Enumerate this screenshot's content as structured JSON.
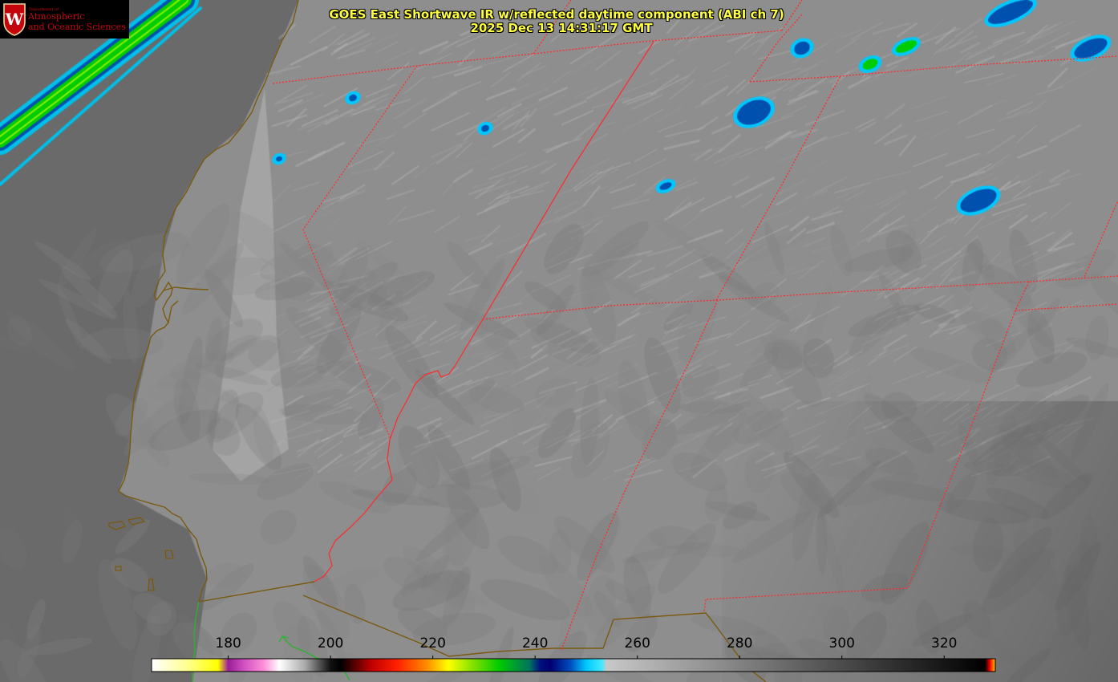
{
  "logo": {
    "dept": "Department of",
    "line1": "Atmospheric",
    "line2": "and Oceanic Sciences",
    "seal_letter": "W"
  },
  "title": {
    "line1": "GOES East Shortwave IR w/reflected daytime component (ABI ch 7)",
    "line2": "2025 Dec 13 14:31:17 GMT"
  },
  "colorbar": {
    "min": 165,
    "max": 330,
    "ticks": [
      180,
      200,
      220,
      240,
      260,
      280,
      300,
      320
    ],
    "stops": [
      {
        "t": 165,
        "color": "#ffffff"
      },
      {
        "t": 172,
        "color": "#ffff90"
      },
      {
        "t": 178,
        "color": "#ffff00"
      },
      {
        "t": 180,
        "color": "#9a1e9a"
      },
      {
        "t": 183,
        "color": "#d050c0"
      },
      {
        "t": 187,
        "color": "#ff90d8"
      },
      {
        "t": 190,
        "color": "#ffffff"
      },
      {
        "t": 195,
        "color": "#aaaaaa"
      },
      {
        "t": 200,
        "color": "#111111"
      },
      {
        "t": 202,
        "color": "#000000"
      },
      {
        "t": 208,
        "color": "#c00000"
      },
      {
        "t": 213,
        "color": "#ff2000"
      },
      {
        "t": 219,
        "color": "#ff9000"
      },
      {
        "t": 223,
        "color": "#ffff00"
      },
      {
        "t": 228,
        "color": "#80e000"
      },
      {
        "t": 233,
        "color": "#00cc00"
      },
      {
        "t": 239,
        "color": "#007060"
      },
      {
        "t": 241,
        "color": "#001080"
      },
      {
        "t": 243,
        "color": "#000070"
      },
      {
        "t": 247,
        "color": "#0050c0"
      },
      {
        "t": 250,
        "color": "#00c8ff"
      },
      {
        "t": 253,
        "color": "#40e8ff"
      },
      {
        "t": 254,
        "color": "#c8c8c8"
      },
      {
        "t": 328,
        "color": "#000000"
      },
      {
        "t": 329,
        "color": "#ff0000"
      },
      {
        "t": 330,
        "color": "#ffd000"
      }
    ]
  },
  "colors": {
    "state_border": "#ff2a2a",
    "coastline": "#7a5a10",
    "coast_green": "#30b030",
    "title_text": "#ffff40"
  }
}
